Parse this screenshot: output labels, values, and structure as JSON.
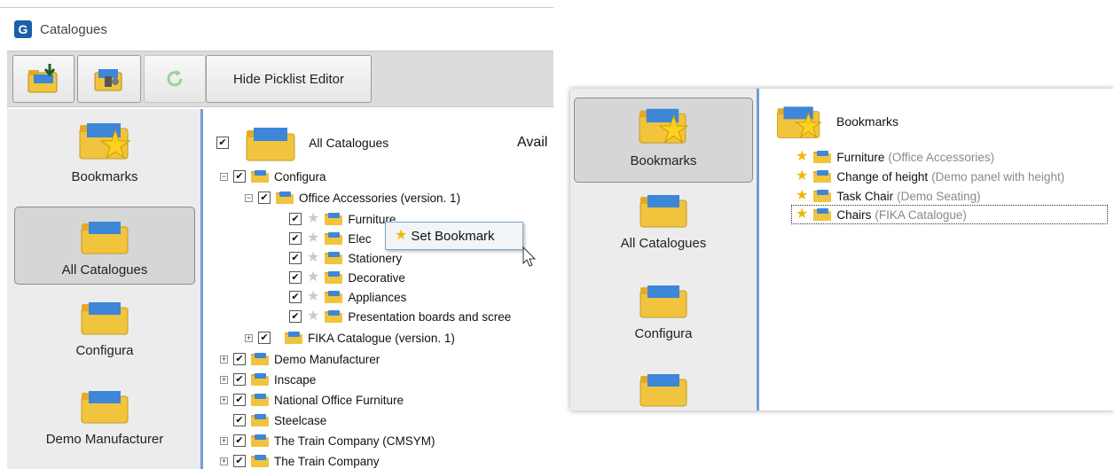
{
  "left_window": {
    "title": "Catalogues",
    "app_icon_letter": "G",
    "toolbar": {
      "hide_picklist_label": "Hide Picklist Editor"
    },
    "sidebar": [
      {
        "label": "Bookmarks",
        "icon": "bookmarks-folder-icon"
      },
      {
        "label": "All Catalogues",
        "icon": "folder-icon",
        "selected": true
      },
      {
        "label": "Configura",
        "icon": "folder-icon"
      },
      {
        "label": "Demo Manufacturer",
        "icon": "folder-icon"
      }
    ],
    "available_label": "Avail",
    "tree": {
      "root": "All Catalogues",
      "configura": "Configura",
      "office_accessories": "Office Accessories (version. 1)",
      "office_children": [
        "Furniture",
        "Elec",
        "Stationery",
        "Decorative",
        "Appliances",
        "Presentation boards and scree"
      ],
      "fika": "FIKA Catalogue (version. 1)",
      "manufacturers": [
        "Demo Manufacturer",
        "Inscape",
        "National Office Furniture",
        "Steelcase",
        "The Train Company (CMSYM)",
        "The Train Company"
      ]
    },
    "context_menu": {
      "set_bookmark_label": "Set Bookmark"
    }
  },
  "right_window": {
    "sidebar": [
      {
        "label": "Bookmarks",
        "selected": true
      },
      {
        "label": "All Catalogues"
      },
      {
        "label": "Configura"
      },
      {
        "label": ""
      }
    ],
    "tree": {
      "root": "Bookmarks",
      "items": [
        {
          "name": "Furniture",
          "source": "(Office Accessories)"
        },
        {
          "name": "Change of height",
          "source": "(Demo panel with height)"
        },
        {
          "name": "Task Chair",
          "source": "(Demo Seating)"
        },
        {
          "name": "Chairs",
          "source": "(FIKA Catalogue)",
          "focused": true
        }
      ]
    }
  },
  "colors": {
    "accent_blue": "#6f9ed6",
    "folder_yellow": "#f0c43c",
    "star_gold": "#f2b705",
    "star_grey": "#c9c9c9"
  }
}
